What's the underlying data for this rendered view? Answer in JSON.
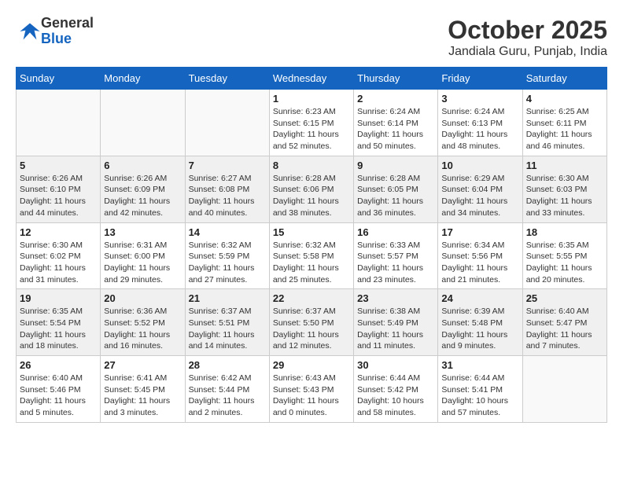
{
  "logo": {
    "general": "General",
    "blue": "Blue"
  },
  "title": "October 2025",
  "location": "Jandiala Guru, Punjab, India",
  "days_of_week": [
    "Sunday",
    "Monday",
    "Tuesday",
    "Wednesday",
    "Thursday",
    "Friday",
    "Saturday"
  ],
  "weeks": [
    {
      "shaded": false,
      "days": [
        {
          "num": "",
          "info": ""
        },
        {
          "num": "",
          "info": ""
        },
        {
          "num": "",
          "info": ""
        },
        {
          "num": "1",
          "info": "Sunrise: 6:23 AM\nSunset: 6:15 PM\nDaylight: 11 hours\nand 52 minutes."
        },
        {
          "num": "2",
          "info": "Sunrise: 6:24 AM\nSunset: 6:14 PM\nDaylight: 11 hours\nand 50 minutes."
        },
        {
          "num": "3",
          "info": "Sunrise: 6:24 AM\nSunset: 6:13 PM\nDaylight: 11 hours\nand 48 minutes."
        },
        {
          "num": "4",
          "info": "Sunrise: 6:25 AM\nSunset: 6:11 PM\nDaylight: 11 hours\nand 46 minutes."
        }
      ]
    },
    {
      "shaded": true,
      "days": [
        {
          "num": "5",
          "info": "Sunrise: 6:26 AM\nSunset: 6:10 PM\nDaylight: 11 hours\nand 44 minutes."
        },
        {
          "num": "6",
          "info": "Sunrise: 6:26 AM\nSunset: 6:09 PM\nDaylight: 11 hours\nand 42 minutes."
        },
        {
          "num": "7",
          "info": "Sunrise: 6:27 AM\nSunset: 6:08 PM\nDaylight: 11 hours\nand 40 minutes."
        },
        {
          "num": "8",
          "info": "Sunrise: 6:28 AM\nSunset: 6:06 PM\nDaylight: 11 hours\nand 38 minutes."
        },
        {
          "num": "9",
          "info": "Sunrise: 6:28 AM\nSunset: 6:05 PM\nDaylight: 11 hours\nand 36 minutes."
        },
        {
          "num": "10",
          "info": "Sunrise: 6:29 AM\nSunset: 6:04 PM\nDaylight: 11 hours\nand 34 minutes."
        },
        {
          "num": "11",
          "info": "Sunrise: 6:30 AM\nSunset: 6:03 PM\nDaylight: 11 hours\nand 33 minutes."
        }
      ]
    },
    {
      "shaded": false,
      "days": [
        {
          "num": "12",
          "info": "Sunrise: 6:30 AM\nSunset: 6:02 PM\nDaylight: 11 hours\nand 31 minutes."
        },
        {
          "num": "13",
          "info": "Sunrise: 6:31 AM\nSunset: 6:00 PM\nDaylight: 11 hours\nand 29 minutes."
        },
        {
          "num": "14",
          "info": "Sunrise: 6:32 AM\nSunset: 5:59 PM\nDaylight: 11 hours\nand 27 minutes."
        },
        {
          "num": "15",
          "info": "Sunrise: 6:32 AM\nSunset: 5:58 PM\nDaylight: 11 hours\nand 25 minutes."
        },
        {
          "num": "16",
          "info": "Sunrise: 6:33 AM\nSunset: 5:57 PM\nDaylight: 11 hours\nand 23 minutes."
        },
        {
          "num": "17",
          "info": "Sunrise: 6:34 AM\nSunset: 5:56 PM\nDaylight: 11 hours\nand 21 minutes."
        },
        {
          "num": "18",
          "info": "Sunrise: 6:35 AM\nSunset: 5:55 PM\nDaylight: 11 hours\nand 20 minutes."
        }
      ]
    },
    {
      "shaded": true,
      "days": [
        {
          "num": "19",
          "info": "Sunrise: 6:35 AM\nSunset: 5:54 PM\nDaylight: 11 hours\nand 18 minutes."
        },
        {
          "num": "20",
          "info": "Sunrise: 6:36 AM\nSunset: 5:52 PM\nDaylight: 11 hours\nand 16 minutes."
        },
        {
          "num": "21",
          "info": "Sunrise: 6:37 AM\nSunset: 5:51 PM\nDaylight: 11 hours\nand 14 minutes."
        },
        {
          "num": "22",
          "info": "Sunrise: 6:37 AM\nSunset: 5:50 PM\nDaylight: 11 hours\nand 12 minutes."
        },
        {
          "num": "23",
          "info": "Sunrise: 6:38 AM\nSunset: 5:49 PM\nDaylight: 11 hours\nand 11 minutes."
        },
        {
          "num": "24",
          "info": "Sunrise: 6:39 AM\nSunset: 5:48 PM\nDaylight: 11 hours\nand 9 minutes."
        },
        {
          "num": "25",
          "info": "Sunrise: 6:40 AM\nSunset: 5:47 PM\nDaylight: 11 hours\nand 7 minutes."
        }
      ]
    },
    {
      "shaded": false,
      "days": [
        {
          "num": "26",
          "info": "Sunrise: 6:40 AM\nSunset: 5:46 PM\nDaylight: 11 hours\nand 5 minutes."
        },
        {
          "num": "27",
          "info": "Sunrise: 6:41 AM\nSunset: 5:45 PM\nDaylight: 11 hours\nand 3 minutes."
        },
        {
          "num": "28",
          "info": "Sunrise: 6:42 AM\nSunset: 5:44 PM\nDaylight: 11 hours\nand 2 minutes."
        },
        {
          "num": "29",
          "info": "Sunrise: 6:43 AM\nSunset: 5:43 PM\nDaylight: 11 hours\nand 0 minutes."
        },
        {
          "num": "30",
          "info": "Sunrise: 6:44 AM\nSunset: 5:42 PM\nDaylight: 10 hours\nand 58 minutes."
        },
        {
          "num": "31",
          "info": "Sunrise: 6:44 AM\nSunset: 5:41 PM\nDaylight: 10 hours\nand 57 minutes."
        },
        {
          "num": "",
          "info": ""
        }
      ]
    }
  ]
}
